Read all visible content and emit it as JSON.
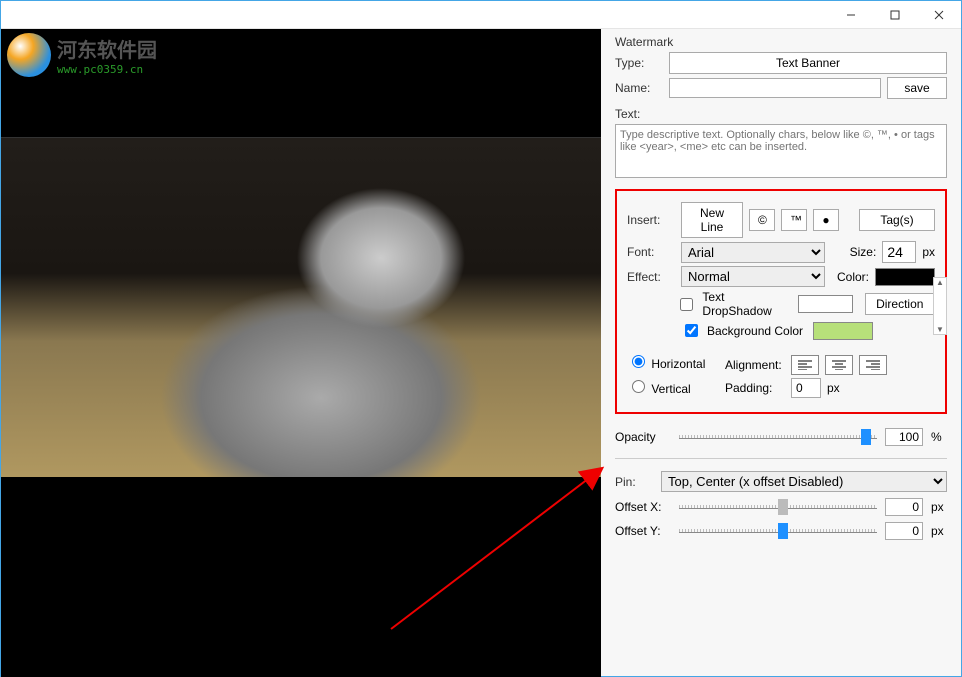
{
  "branding": {
    "title": "河东软件园",
    "url": "www.pc0359.cn"
  },
  "watermark": {
    "section_label": "Watermark",
    "type_label": "Type:",
    "type_value": "Text Banner",
    "name_label": "Name:",
    "name_value": "",
    "save_label": "save"
  },
  "text": {
    "section_label": "Text:",
    "placeholder": "Type descriptive text. Optionally chars, below like ©, ™, • or tags like <year>, <me> etc can be inserted."
  },
  "insert": {
    "label": "Insert:",
    "new_line": "New Line",
    "copyright": "©",
    "trademark": "™",
    "bullet": "●",
    "tags": "Tag(s)"
  },
  "font": {
    "label": "Font:",
    "value": "Arial",
    "size_label": "Size:",
    "size_value": "24",
    "size_unit": "px"
  },
  "effect": {
    "label": "Effect:",
    "value": "Normal",
    "color_label": "Color:"
  },
  "dropshadow": {
    "label": "Text DropShadow",
    "checked": false
  },
  "bgcolor": {
    "label": "Background Color",
    "checked": true
  },
  "direction_btn": "Direction",
  "orientation": {
    "horizontal": "Horizontal",
    "vertical": "Vertical",
    "selected": "horizontal"
  },
  "alignment": {
    "label": "Alignment:"
  },
  "padding": {
    "label": "Padding:",
    "value": "0",
    "unit": "px"
  },
  "opacity": {
    "label": "Opacity",
    "value": "100",
    "unit": "%",
    "pos": 92
  },
  "pin": {
    "label": "Pin:",
    "value": "Top, Center (x offset Disabled)"
  },
  "offset_x": {
    "label": "Offset X:",
    "value": "0",
    "unit": "px",
    "pos": 50
  },
  "offset_y": {
    "label": "Offset Y:",
    "value": "0",
    "unit": "px",
    "pos": 50
  }
}
